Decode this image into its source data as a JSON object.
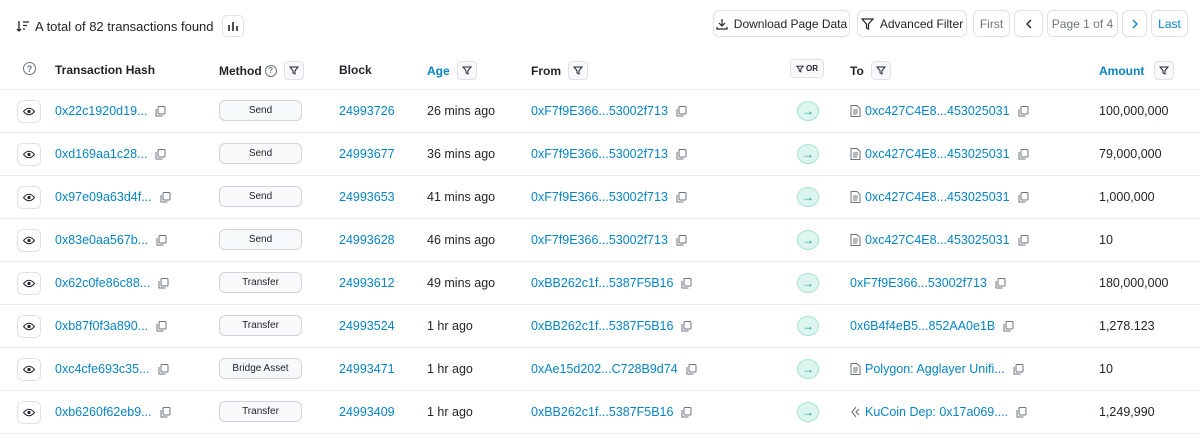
{
  "summary": {
    "text": "A total of 82 transactions found"
  },
  "toolbar": {
    "download_label": "Download Page Data",
    "filter_label": "Advanced Filter",
    "first_label": "First",
    "page_label": "Page 1 of 4",
    "last_label": "Last"
  },
  "columns": {
    "hash": "Transaction Hash",
    "method": "Method",
    "block": "Block",
    "age": "Age",
    "from": "From",
    "or": "OR",
    "to": "To",
    "amount": "Amount"
  },
  "rows": [
    {
      "hash": "0x22c1920d19...",
      "method": "Send",
      "block": "24993726",
      "age": "26 mins ago",
      "from": "0xF7f9E366...53002f713",
      "to": "0xc427C4E8...453025031",
      "to_icon": "contract-icon",
      "amount": "100,000,000"
    },
    {
      "hash": "0xd169aa1c28...",
      "method": "Send",
      "block": "24993677",
      "age": "36 mins ago",
      "from": "0xF7f9E366...53002f713",
      "to": "0xc427C4E8...453025031",
      "to_icon": "contract-icon",
      "amount": "79,000,000"
    },
    {
      "hash": "0x97e09a63d4f...",
      "method": "Send",
      "block": "24993653",
      "age": "41 mins ago",
      "from": "0xF7f9E366...53002f713",
      "to": "0xc427C4E8...453025031",
      "to_icon": "contract-icon",
      "amount": "1,000,000"
    },
    {
      "hash": "0x83e0aa567b...",
      "method": "Send",
      "block": "24993628",
      "age": "46 mins ago",
      "from": "0xF7f9E366...53002f713",
      "to": "0xc427C4E8...453025031",
      "to_icon": "contract-icon",
      "amount": "10"
    },
    {
      "hash": "0x62c0fe86c88...",
      "method": "Transfer",
      "block": "24993612",
      "age": "49 mins ago",
      "from": "0xBB262c1f...5387F5B16",
      "to": "0xF7f9E366...53002f713",
      "to_icon": "",
      "amount": "180,000,000"
    },
    {
      "hash": "0xb87f0f3a890...",
      "method": "Transfer",
      "block": "24993524",
      "age": "1 hr ago",
      "from": "0xBB262c1f...5387F5B16",
      "to": "0x6B4f4eB5...852AA0e1B",
      "to_icon": "",
      "amount": "1,278.123"
    },
    {
      "hash": "0xc4cfe693c35...",
      "method": "Bridge Asset",
      "block": "24993471",
      "age": "1 hr ago",
      "from": "0xAe15d202...C728B9d74",
      "to": "Polygon: Agglayer Unifi...",
      "to_icon": "contract-icon",
      "amount": "10"
    },
    {
      "hash": "0xb6260f62eb9...",
      "method": "Transfer",
      "block": "24993409",
      "age": "1 hr ago",
      "from": "0xBB262c1f...5387F5B16",
      "to": "KuCoin Dep: 0x17a069....",
      "to_icon": "kucoin-icon",
      "amount": "1,249,990"
    }
  ]
}
